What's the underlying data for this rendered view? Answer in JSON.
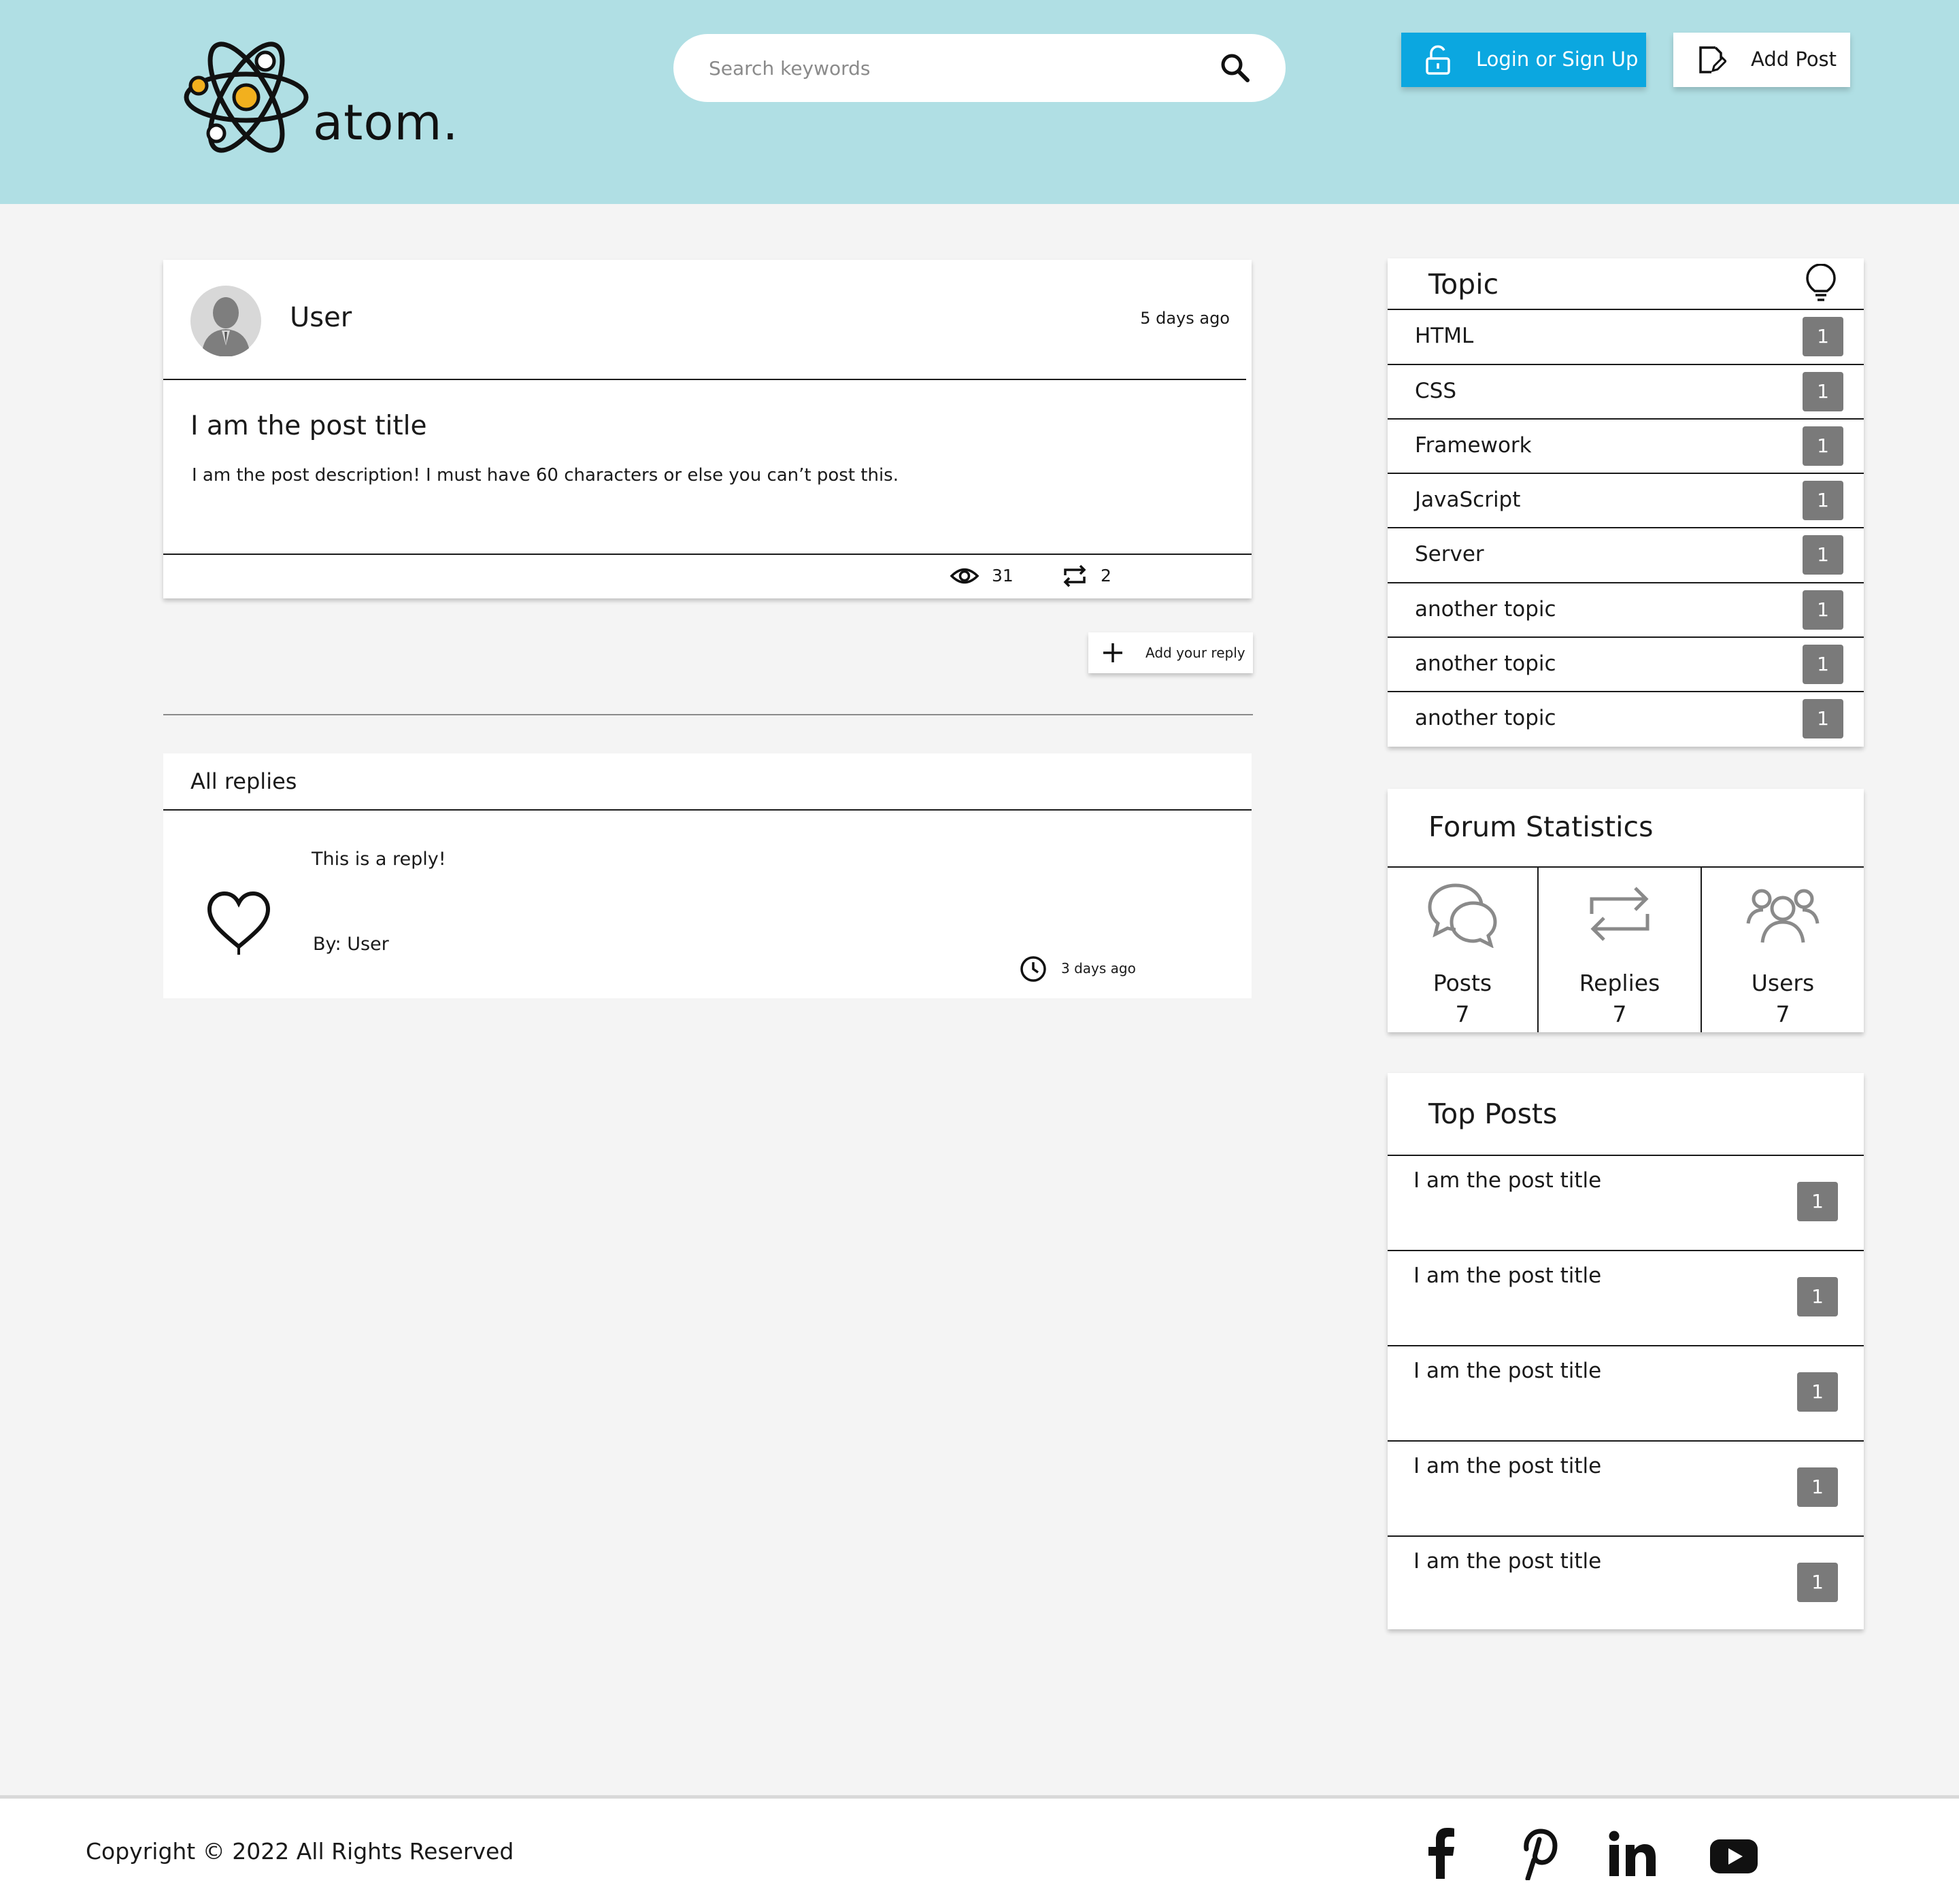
{
  "header": {
    "logo_text": "atom.",
    "search_placeholder": "Search keywords",
    "login_label": "Login or Sign Up",
    "add_post_label": "Add Post",
    "bg_color": "#b0dfe4",
    "login_color": "#0ba7e0"
  },
  "post": {
    "author": "User",
    "time": "5 days ago",
    "title": "I am the post title",
    "description": "I am the post description! I must have 60 characters or else you can’t post this.",
    "views": "31",
    "replies": "2"
  },
  "add_reply_label": "Add your reply",
  "replies": {
    "heading": "All replies",
    "items": [
      {
        "text": "This is a reply!",
        "by": "By: User",
        "time": "3 days ago"
      }
    ]
  },
  "topics": {
    "heading": "Topic",
    "items": [
      {
        "name": "HTML",
        "count": "1"
      },
      {
        "name": "CSS",
        "count": "1"
      },
      {
        "name": "Framework",
        "count": "1"
      },
      {
        "name": "JavaScript",
        "count": "1"
      },
      {
        "name": "Server",
        "count": "1"
      },
      {
        "name": "another topic",
        "count": "1"
      },
      {
        "name": "another topic",
        "count": "1"
      },
      {
        "name": "another topic",
        "count": "1"
      }
    ]
  },
  "stats": {
    "heading": "Forum Statistics",
    "items": [
      {
        "label": "Posts",
        "value": "7",
        "icon": "chat-bubbles-icon"
      },
      {
        "label": "Replies",
        "value": "7",
        "icon": "repeat-icon"
      },
      {
        "label": "Users",
        "value": "7",
        "icon": "users-icon"
      }
    ]
  },
  "top_posts": {
    "heading": "Top Posts",
    "items": [
      {
        "title": "I am the post title",
        "count": "1"
      },
      {
        "title": "I am the post title",
        "count": "1"
      },
      {
        "title": "I am the post title",
        "count": "1"
      },
      {
        "title": "I am the post title",
        "count": "1"
      },
      {
        "title": "I am the post title",
        "count": "1"
      }
    ]
  },
  "footer": {
    "copyright": "Copyright © 2022 All Rights Reserved",
    "social": [
      "facebook-icon",
      "pinterest-icon",
      "linkedin-icon",
      "youtube-icon"
    ]
  }
}
